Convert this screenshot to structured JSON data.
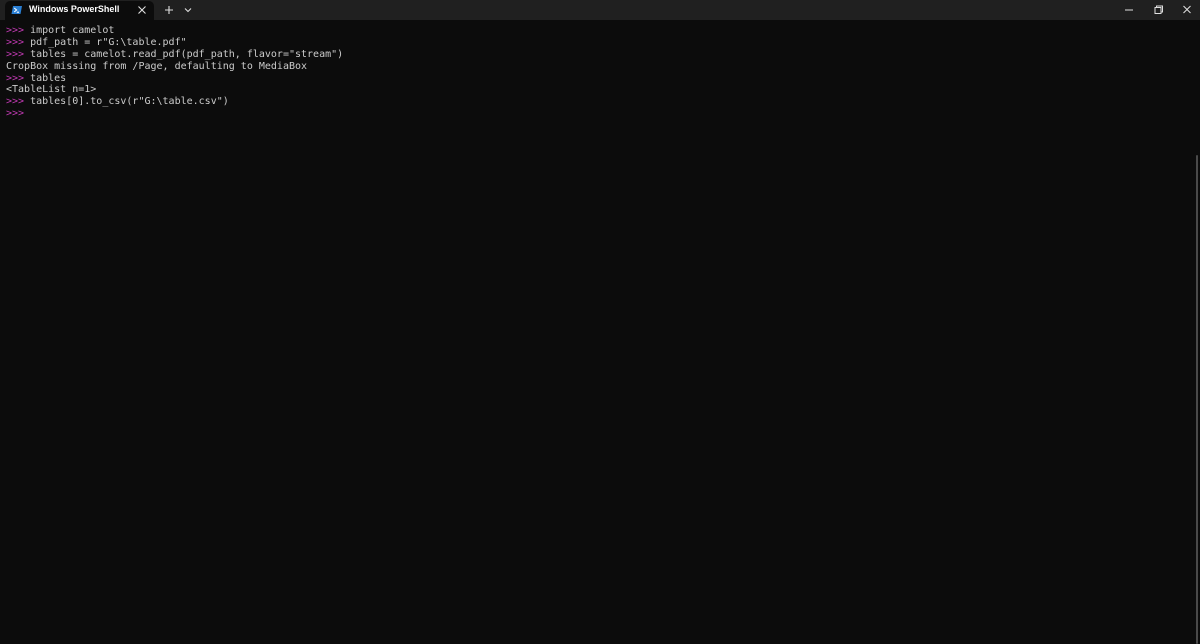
{
  "tab": {
    "title": "Windows PowerShell",
    "icon": "powershell-icon"
  },
  "titlebar": {
    "new_tab_icon": "plus-icon",
    "dropdown_icon": "chevron-down-icon",
    "minimize_icon": "minimize-icon",
    "restore_icon": "restore-icon",
    "close_icon": "close-icon"
  },
  "colors": {
    "background": "#0c0c0c",
    "titlebar": "#202020",
    "text": "#cccccc",
    "prompt": "#c239b3"
  },
  "terminal": {
    "lines": [
      {
        "prompt": ">>>",
        "text": " import camelot"
      },
      {
        "prompt": ">>>",
        "text": " pdf_path = r\"G:\\table.pdf\""
      },
      {
        "prompt": ">>>",
        "text": " tables = camelot.read_pdf(pdf_path, flavor=\"stream\")"
      },
      {
        "prompt": "",
        "text": "CropBox missing from /Page, defaulting to MediaBox"
      },
      {
        "prompt": ">>>",
        "text": " tables"
      },
      {
        "prompt": "",
        "text": "<TableList n=1>"
      },
      {
        "prompt": ">>>",
        "text": " tables[0].to_csv(r\"G:\\table.csv\")"
      },
      {
        "prompt": ">>>",
        "text": ""
      }
    ]
  }
}
